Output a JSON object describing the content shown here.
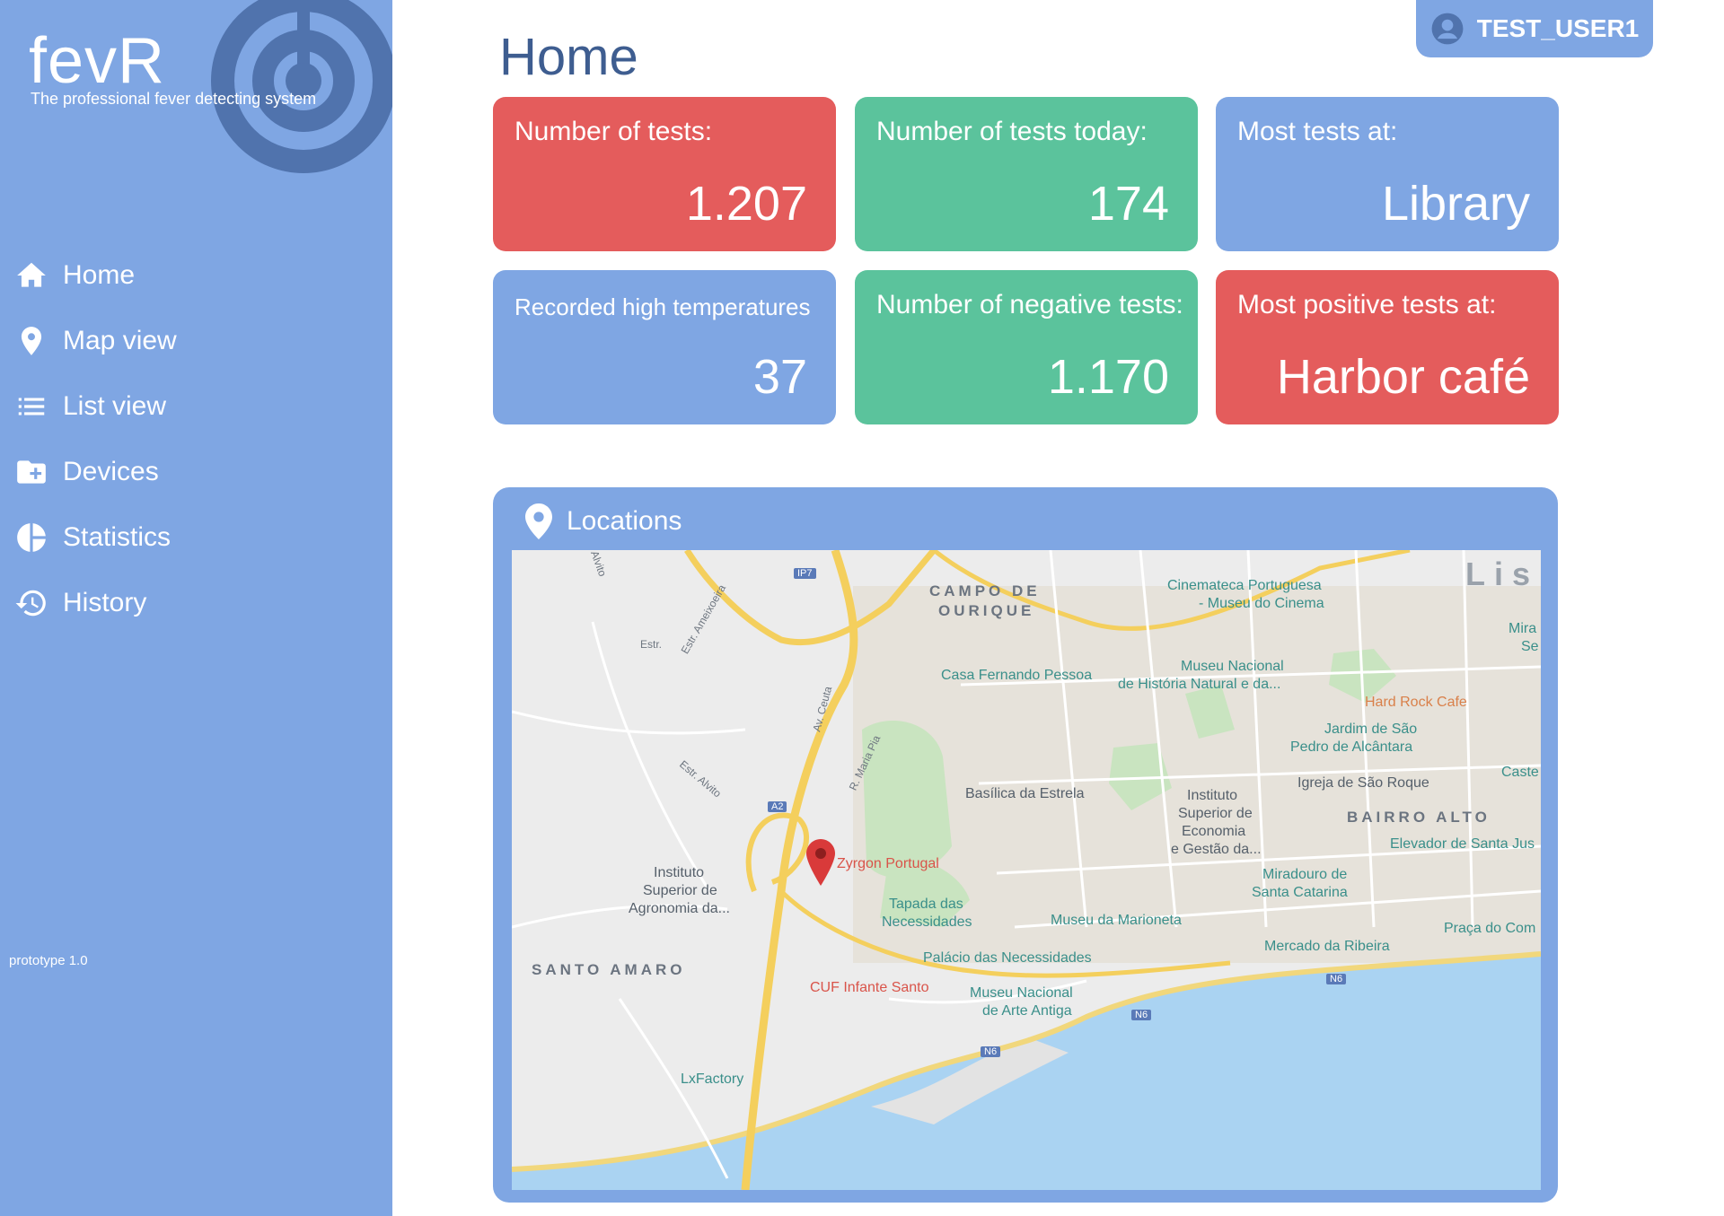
{
  "brand": {
    "name": "fevR",
    "tagline": "The professional fever detecting system"
  },
  "sidebar": {
    "items": [
      {
        "label": "Home",
        "icon": "home-icon"
      },
      {
        "label": "Map view",
        "icon": "map-pin-icon"
      },
      {
        "label": "List view",
        "icon": "list-icon"
      },
      {
        "label": "Devices",
        "icon": "folder-plus-icon"
      },
      {
        "label": "Statistics",
        "icon": "pie-chart-icon"
      },
      {
        "label": "History",
        "icon": "history-icon"
      }
    ],
    "version": "prototype 1.0"
  },
  "header": {
    "title": "Home",
    "user": "TEST_USER1"
  },
  "cards": [
    {
      "label": "Number of tests:",
      "value": "1.207",
      "color": "#e45c5c"
    },
    {
      "label": "Number of tests today:",
      "value": "174",
      "color": "#5bc39c"
    },
    {
      "label": "Most tests at:",
      "value": "Library",
      "color": "#7fa6e3"
    },
    {
      "label": "Recorded high temperatures",
      "value": "37",
      "color": "#7fa6e3"
    },
    {
      "label": "Number of negative tests:",
      "value": "1.170",
      "color": "#5bc39c"
    },
    {
      "label": "Most positive tests at:",
      "value": "Harbor café",
      "color": "#e45c5c"
    }
  ],
  "map": {
    "title": "Locations",
    "marker": "Zyrgon Portugal",
    "districts": [
      "CAMPO DE",
      "OURIQUE",
      "SANTO AMARO",
      "BAIRRO ALTO",
      "Lisb"
    ],
    "places": [
      "Cinemateca Portuguesa",
      "- Museu do Cinema",
      "Casa Fernando Pessoa",
      "Museu Nacional",
      "de História Natural e da...",
      "Hard Rock Cafe",
      "Jardim de São",
      "Pedro de Alcântara",
      "Igreja de São Roque",
      "Basílica da Estrela",
      "Instituto",
      "Superior de",
      "Economia",
      "e Gestão da...",
      "Elevador de Santa Jus",
      "Miradouro de",
      "Santa Catarina",
      "Tapada das",
      "Necessidades",
      "Museu da Marioneta",
      "Palácio das Necessidades",
      "Instituto",
      "Superior de",
      "Agronomia da...",
      "Mercado da Ribeira",
      "Praça do Com",
      "CUF Infante Santo",
      "Museu Nacional",
      "de Arte Antiga",
      "LxFactory",
      "Mira",
      "Se",
      "Caste"
    ],
    "streets": [
      "Estr. Alvito",
      "Av. Ceuta",
      "R. Maria Pia",
      "Estr. Ameixoeira",
      "Estr.",
      "Alvito"
    ],
    "roads": [
      "IP7",
      "A2",
      "N6",
      "N6",
      "N6"
    ]
  },
  "colors": {
    "sidebar": "#7fa6e3",
    "red": "#e45c5c",
    "green": "#5bc39c",
    "blue": "#7fa6e3",
    "title": "#3e5d90"
  }
}
